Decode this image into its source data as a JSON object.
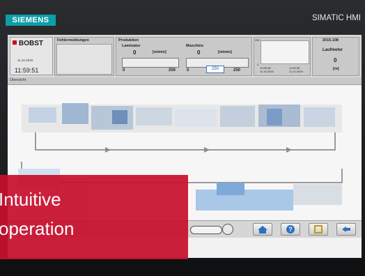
{
  "brand": {
    "siemens_logo": "SIEMENS",
    "device_name": "SIMATIC HMI"
  },
  "header": {
    "bobst": {
      "logo": "BOBST",
      "date": "11.10.2016",
      "time": "11:59:51"
    },
    "fehler": {
      "title": "Fehlermeldungen"
    },
    "produktion": {
      "title": "Produktion",
      "laminator": {
        "title": "Laminator",
        "value": "0",
        "unit": "[m/min]",
        "min": "0",
        "max": "250"
      },
      "maschine": {
        "title": "Maschine",
        "value": "0",
        "unit": "[m/min]",
        "setpoint": "250",
        "min": "0",
        "max": "250"
      }
    },
    "trend": {
      "ymax": "250",
      "ymin": "0",
      "t1": "10:59:36\n11.10.2016",
      "t2": "11:59:36\n11.10.2016"
    },
    "laufmeter": {
      "code": "2015.108",
      "title": "Laufmeter",
      "value": "0",
      "unit": "[m]"
    }
  },
  "subheader": {
    "label": "Übersicht"
  },
  "banner": {
    "line1": "Intuitive",
    "line2": "operation"
  },
  "colors": {
    "banner": "#c8102e",
    "siemens": "#0e9ea8",
    "machine_blue": "#7ea9d8"
  }
}
